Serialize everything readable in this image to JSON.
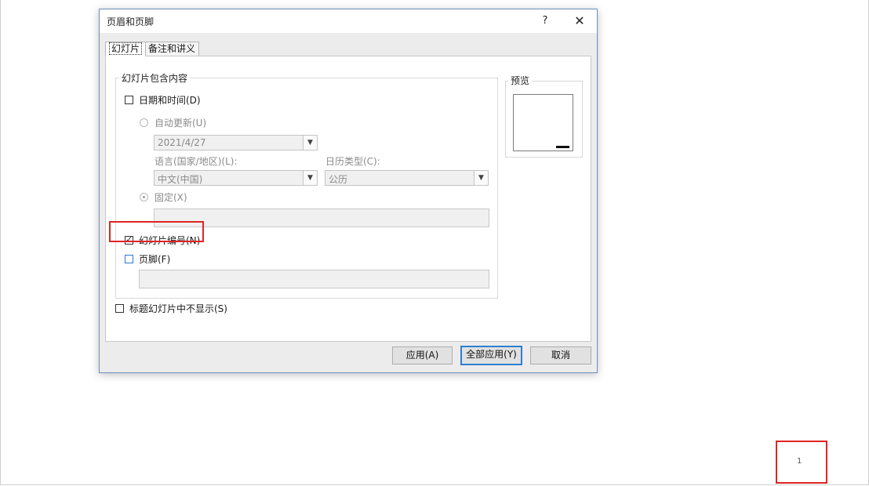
{
  "dialog": {
    "title": "页眉和页脚",
    "help": "?",
    "close": "✕"
  },
  "tabs": [
    {
      "label": "幻灯片",
      "active": true
    },
    {
      "label": "备注和讲义",
      "active": false
    }
  ],
  "slide_content": {
    "group_label": "幻灯片包含内容",
    "date_time": {
      "label": "日期和时间(D)",
      "checked": false
    },
    "auto_update": {
      "label": "自动更新(U)",
      "selected": false
    },
    "date_value": "2021/4/27",
    "language_label": "语言(国家/地区)(L):",
    "language_value": "中文(中国)",
    "calendar_label": "日历类型(C):",
    "calendar_value": "公历",
    "fixed": {
      "label": "固定(X)",
      "selected": true
    },
    "fixed_value": "",
    "slide_number": {
      "label": "幻灯片编号(N)",
      "checked": true
    },
    "footer": {
      "label": "页脚(F)",
      "checked": false
    },
    "footer_value": ""
  },
  "title_slide": {
    "label": "标题幻灯片中不显示(S)",
    "checked": false
  },
  "preview": {
    "label": "预览"
  },
  "buttons": {
    "apply": "应用(A)",
    "apply_all": "全部应用(Y)",
    "cancel": "取消"
  },
  "slide_page_number": "1",
  "colors": {
    "highlight": "#e02424",
    "focus_blue": "#2e7fd2"
  },
  "icons": {
    "close": "close-icon",
    "help": "help-icon",
    "dropdown": "chevron-down-icon",
    "checkmark": "checkmark-icon"
  }
}
